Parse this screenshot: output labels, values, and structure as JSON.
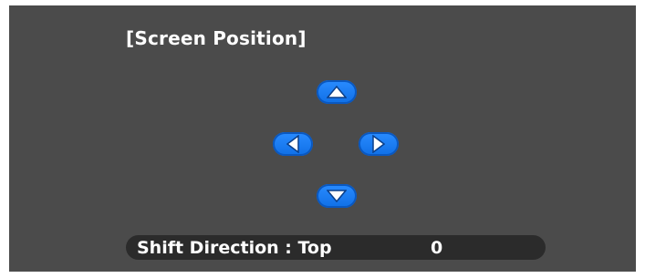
{
  "osd": {
    "title": "[Screen Position]",
    "controls": {
      "up_icon": "triangle-up-icon",
      "down_icon": "triangle-down-icon",
      "left_icon": "triangle-left-icon",
      "right_icon": "triangle-right-icon"
    },
    "status": {
      "label": "Shift Direction : Top",
      "value": "0"
    }
  },
  "colors": {
    "background": "#4b4b4b",
    "button_fill": "#1a7cf5",
    "status_bar": "#2b2b2b",
    "text": "#ffffff"
  }
}
